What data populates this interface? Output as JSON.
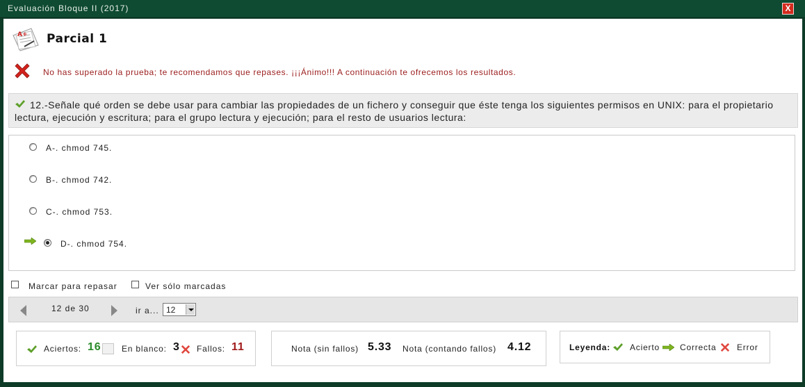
{
  "window": {
    "title": "Evaluación Bloque II (2017)",
    "close_label": "X"
  },
  "header": {
    "title": "Parcial 1",
    "icon": "exam-paper-icon"
  },
  "result": {
    "message": "No has superado la prueba; te recomendamos que repases. ¡¡¡Ánimo!!! A continuación te ofrecemos los resultados."
  },
  "question": {
    "text": "12.-Señale qué orden se debe usar para cambiar las propiedades de un fichero y conseguir que éste tenga los siguientes permisos en UNIX: para el propietario lectura, ejecución y escritura; para el grupo lectura y ejecución; para el resto de usuarios lectura:"
  },
  "answers": [
    {
      "label": "A-. chmod 745.",
      "selected": false,
      "correct": false
    },
    {
      "label": "B-. chmod 742.",
      "selected": false,
      "correct": false
    },
    {
      "label": "C-. chmod 753.",
      "selected": false,
      "correct": false
    },
    {
      "label": "D-. chmod 754.",
      "selected": true,
      "correct": true
    }
  ],
  "marks": {
    "mark_label": "Marcar para repasar",
    "only_marked_label": "Ver sólo marcadas"
  },
  "pager": {
    "position": "12 de 30",
    "goto_label": "ir a...",
    "selected": "12"
  },
  "stats": {
    "aciertos_label": "Aciertos:",
    "aciertos": "16",
    "blanco_label": "En blanco:",
    "blanco": "3",
    "fallos_label": "Fallos:",
    "fallos": "11"
  },
  "grades": {
    "sin_fallos_label": "Nota (sin fallos)",
    "sin_fallos": "5.33",
    "con_fallos_label": "Nota (contando fallos)",
    "con_fallos": "4.12"
  },
  "legend": {
    "title": "Leyenda:",
    "acierto": "Acierto",
    "correcta": "Correcta",
    "error": "Error"
  },
  "colors": {
    "titlebar": "#0f4a32",
    "error_text": "#9b1c1c",
    "correct_green": "#2a8a2a",
    "fail_red": "#a11a1a"
  }
}
